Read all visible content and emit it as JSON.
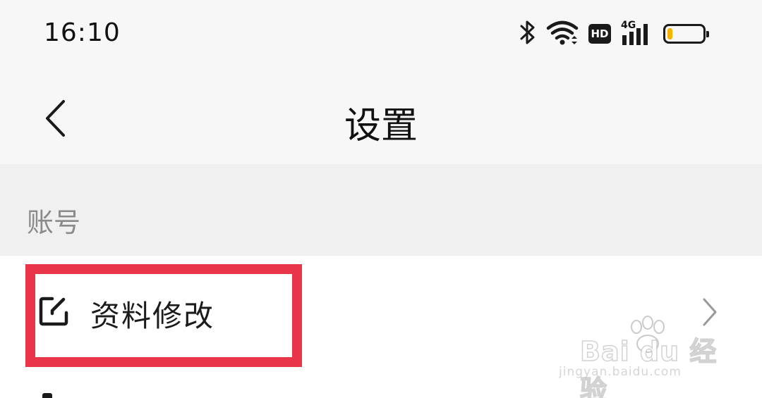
{
  "status_bar": {
    "time": "16:10",
    "icons": [
      "bluetooth-icon",
      "wifi-icon",
      "hd-badge",
      "cellular-signal-icon",
      "battery-icon"
    ],
    "hd_label": "HD",
    "network_label": "4G",
    "battery_level": 0.15,
    "battery_color": "#f4b400"
  },
  "header": {
    "back_icon": "chevron-left-icon",
    "title": "设置"
  },
  "sections": [
    {
      "label": "账号",
      "items": [
        {
          "label": "资料修改",
          "icon": "edit-icon",
          "trailing_icon": "chevron-right-icon",
          "highlighted": true
        }
      ]
    }
  ],
  "highlight_color": "#e8354a",
  "watermark": {
    "brand": "Bai du 经验",
    "url": "jingyan.baidu.com"
  }
}
